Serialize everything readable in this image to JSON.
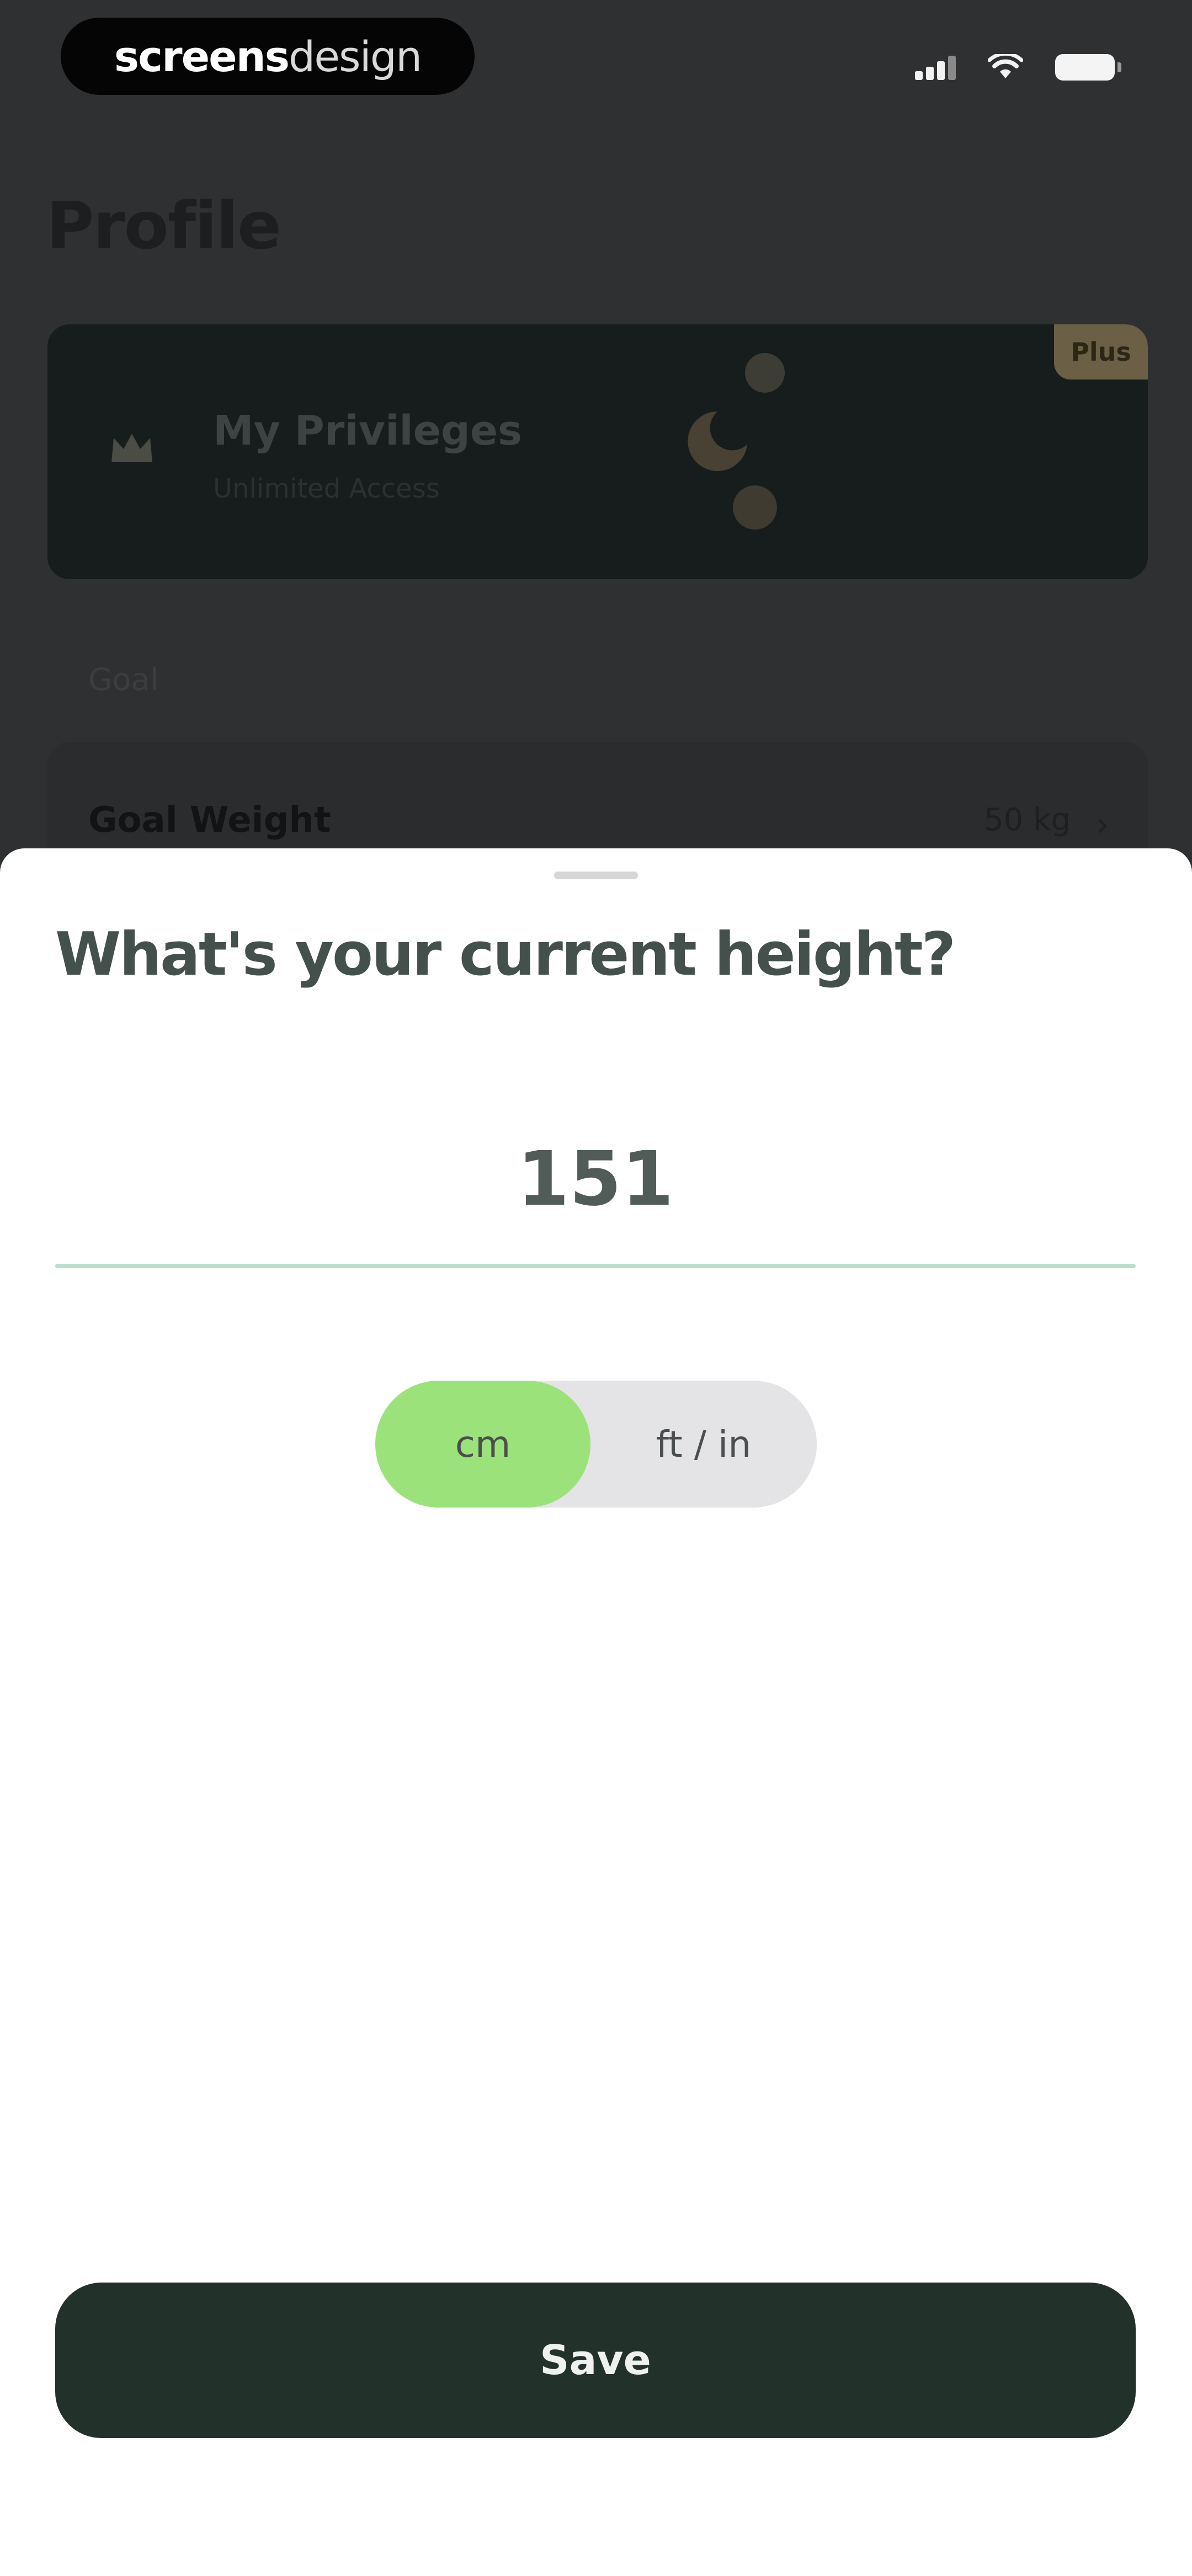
{
  "status_bar": {
    "brand_bold": "screens",
    "brand_light": "design",
    "icons": [
      "signal-icon",
      "wifi-icon",
      "battery-icon"
    ]
  },
  "background": {
    "page_title": "Profile",
    "privileges_title": "My Privileges",
    "privileges_subtitle": "Unlimited Access",
    "plus_badge": "Plus",
    "section_label": "Goal",
    "goal_label": "Goal Weight",
    "goal_value": "50 kg"
  },
  "sheet": {
    "title": "What's your current height?",
    "height_value": "151",
    "units": {
      "selected": "cm",
      "options": [
        "cm",
        "ft / in"
      ]
    },
    "save_label": "Save"
  },
  "colors": {
    "accent_green": "#9ce27a",
    "button_dark": "#223129",
    "underline": "#b6e0cd"
  }
}
